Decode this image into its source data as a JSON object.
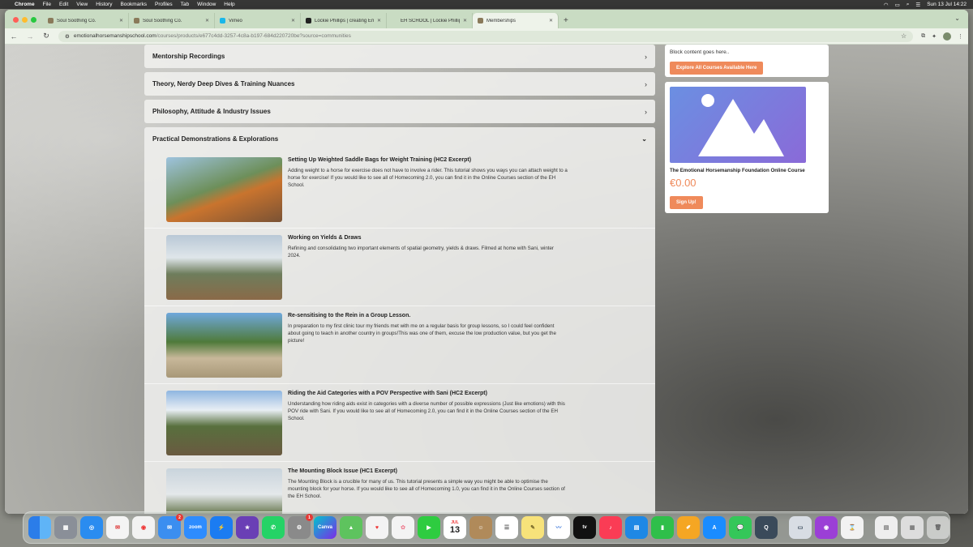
{
  "menubar": {
    "app": "Chrome",
    "items": [
      "File",
      "Edit",
      "View",
      "History",
      "Bookmarks",
      "Profiles",
      "Tab",
      "Window",
      "Help"
    ],
    "clock": "Sun 13 Jul  14:22"
  },
  "tabs": [
    {
      "title": "Soul Soothing Co.",
      "active": false
    },
    {
      "title": "Soul Soothing Co.",
      "active": false
    },
    {
      "title": "Vimeo",
      "active": false
    },
    {
      "title": "Lockie Phillips | creating Emo",
      "active": false
    },
    {
      "title": "EH SCHOOL | Lockie Phillips",
      "active": false
    },
    {
      "title": "Memberships",
      "active": true
    }
  ],
  "address": {
    "domain": "emotionalhorsemanshipschool.com",
    "path": "/courses/products/e677c4dd-3257-4c8a-b197-684d220720be?source=communities"
  },
  "accordions": [
    {
      "title": "Mentorship Recordings"
    },
    {
      "title": "Theory, Nerdy Deep Dives & Training Nuances"
    },
    {
      "title": "Philosophy, Attitude & Industry Issues"
    }
  ],
  "open_section": {
    "title": "Practical Demonstrations & Explorations",
    "lessons": [
      {
        "title": "Setting Up Weighted Saddle Bags for Weight Training (HC2 Excerpt)",
        "desc": "Adding weight to a horse for exercise does not have to involve a rider. This tutorial shows you ways you can attach weight to a horse for exercise! If you would like to see all of Homecoming 2.0, you can find it in the Online Courses section of the EH School."
      },
      {
        "title": "Working on Yields & Draws",
        "desc": "Refining and consolidating two important elements of spatial geometry, yields & draws. Filmed at home with Sani, winter 2024."
      },
      {
        "title": "Re-sensitising to the Rein in a Group Lesson.",
        "desc": "In preparation to my first clinic tour my friends met with me on a regular basis for group lessons, so I could feel confident about going to teach in another country in groups!This was one of them, excuse the low production value, but you get the picture!"
      },
      {
        "title": "Riding the Aid Categories with a POV Perspective with Sani (HC2 Excerpt)",
        "desc": "Understanding how riding aids exist in categories with a diverse number of possible expressions (Just like emotions) with this POV ride with Sani. If you would like to see all of Homecoming 2.0, you can find it in the Online Courses section of the EH School."
      },
      {
        "title": "The Mounting Block Issue (HC1 Excerpt)",
        "desc": "The Mounting Block is a crucible for many of us. This tutorial presents a simple way you might be able to optimise the mounting block for your horse. If you would like to see all of Homecoming 1.0, you can find it in the Online Courses section of the EH School."
      }
    ]
  },
  "sidebar": {
    "block_text": "Block content goes here..",
    "explore_button": "Explore All Courses Available Here",
    "course_title": "The Emotional Horsemanship Foundation Online Course",
    "price": "€0.00",
    "signup_button": "Sign Up!"
  },
  "dock": {
    "mail_badge": "2",
    "settings_badge": "1",
    "zoom_label": "zoom",
    "canva_label": "Canva",
    "calendar_month": "JUL",
    "calendar_day": "13",
    "tv_label": "tv"
  },
  "colors": {
    "accent": "#ef8a5b",
    "tabbar": "#c9dcc3"
  }
}
